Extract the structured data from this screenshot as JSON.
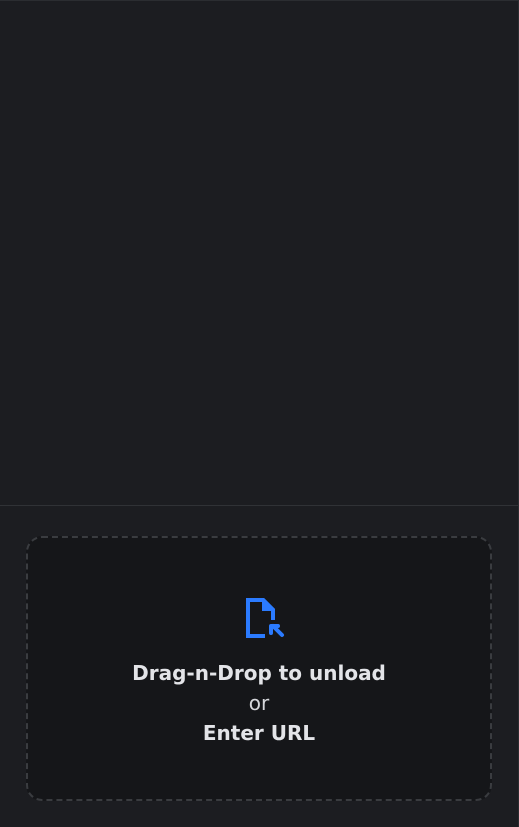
{
  "colors": {
    "background": "#1c1d21",
    "panel": "#151619",
    "border": "#3a3c40",
    "accent": "#2b7bff",
    "text": "#e3e4e8"
  },
  "dropzone": {
    "icon": "file-upload-icon",
    "primary_text": "Drag-n-Drop to unload",
    "separator_text": "or",
    "url_text": "Enter URL"
  }
}
